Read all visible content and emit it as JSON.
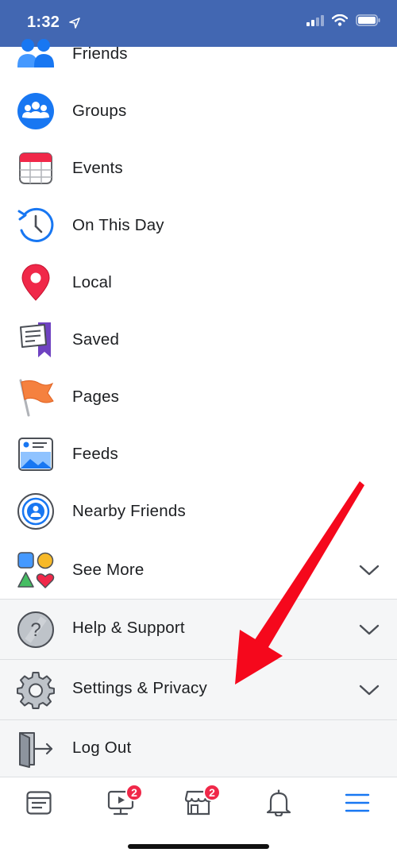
{
  "status_bar": {
    "time": "1:32"
  },
  "menu": {
    "items": [
      {
        "label": "Friends",
        "icon": "friends-icon"
      },
      {
        "label": "Groups",
        "icon": "groups-icon"
      },
      {
        "label": "Events",
        "icon": "events-calendar-icon"
      },
      {
        "label": "On This Day",
        "icon": "on-this-day-clock-icon"
      },
      {
        "label": "Local",
        "icon": "local-pin-icon"
      },
      {
        "label": "Saved",
        "icon": "saved-bookmark-icon"
      },
      {
        "label": "Pages",
        "icon": "pages-flag-icon"
      },
      {
        "label": "Feeds",
        "icon": "feeds-icon"
      },
      {
        "label": "Nearby Friends",
        "icon": "nearby-friends-icon"
      },
      {
        "label": "See More",
        "icon": "see-more-shapes-icon"
      }
    ],
    "sections": [
      {
        "label": "Help & Support",
        "icon": "help-question-icon"
      },
      {
        "label": "Settings & Privacy",
        "icon": "settings-gear-icon"
      },
      {
        "label": "Log Out",
        "icon": "log-out-door-icon"
      }
    ]
  },
  "tabbar": {
    "tabs": [
      {
        "name": "news-feed-tab",
        "icon": "news-feed-icon",
        "badge": ""
      },
      {
        "name": "watch-tab",
        "icon": "watch-video-icon",
        "badge": "2"
      },
      {
        "name": "marketplace-tab",
        "icon": "marketplace-shop-icon",
        "badge": "2"
      },
      {
        "name": "notifications-tab",
        "icon": "bell-icon",
        "badge": ""
      },
      {
        "name": "menu-tab",
        "icon": "hamburger-menu-icon",
        "badge": ""
      }
    ]
  },
  "colors": {
    "brand": "#4267b2",
    "badge": "#f02849",
    "annotation_arrow": "#f5081c",
    "active_tab": "#1877f2"
  }
}
